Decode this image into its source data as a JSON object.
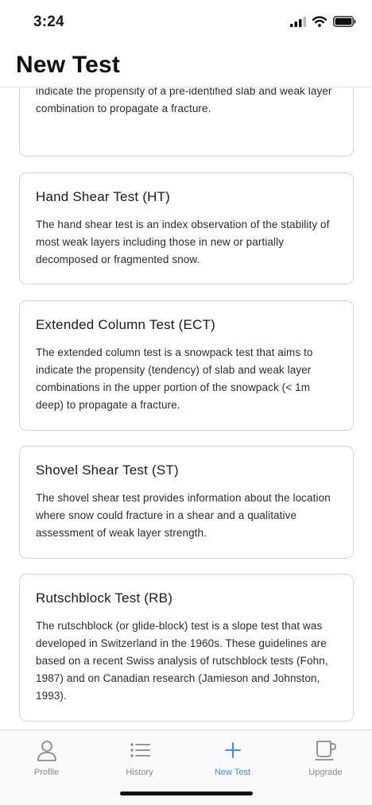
{
  "status_bar": {
    "time": "3:24"
  },
  "header": {
    "title": "New Test"
  },
  "tests": [
    {
      "title": "",
      "description": "The propagation saw test is a snowpack test that aims to indicate the propensity of a pre-identified slab and weak layer combination to propagate a fracture."
    },
    {
      "title": "Hand Shear Test (HT)",
      "description": "The hand shear test is an index observation of the stability of most weak layers including those in new or partially decomposed or fragmented snow."
    },
    {
      "title": "Extended Column Test (ECT)",
      "description": "The extended column test is a snowpack test that aims to indicate the propensity (tendency) of slab and weak layer combinations in the upper portion of the snowpack (< 1m deep) to propagate a fracture."
    },
    {
      "title": "Shovel Shear Test (ST)",
      "description": "The shovel shear test provides information about the location where snow could fracture in a shear and a qualitative assessment of weak layer strength."
    },
    {
      "title": "Rutschblock Test (RB)",
      "description": "The rutschblock (or glide-block) test is a slope test that was developed in Switzerland in the 1960s. These guidelines are based on a recent Swiss analysis of rutschblock tests (Fohn, 1987) and on Canadian research (Jamieson and Johnston, 1993)."
    }
  ],
  "tab_bar": {
    "items": [
      {
        "label": "Profile",
        "icon": "person-icon",
        "active": false
      },
      {
        "label": "History",
        "icon": "list-icon",
        "active": false
      },
      {
        "label": "New Test",
        "icon": "plus-icon",
        "active": true
      },
      {
        "label": "Upgrade",
        "icon": "coffee-cup-icon",
        "active": false
      }
    ]
  },
  "colors": {
    "accent": "#3b8ff0",
    "inactive": "#8a8a8e",
    "card_border": "#d6d6da"
  }
}
